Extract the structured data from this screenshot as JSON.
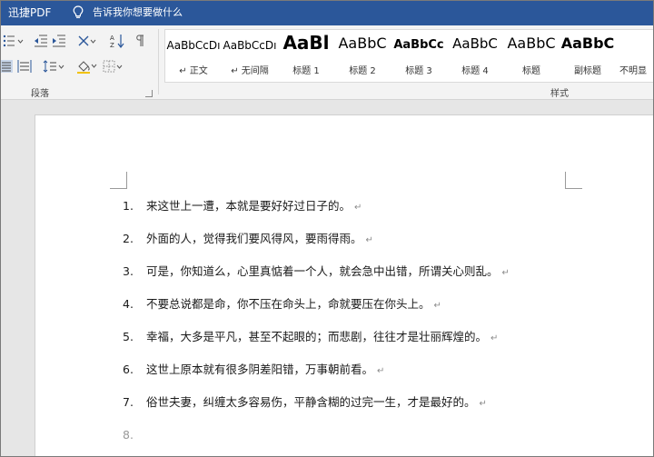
{
  "app": {
    "title": "迅捷PDF",
    "tell_me": "告诉我你想要做什么"
  },
  "ribbon": {
    "paragraph_group_label": "段落",
    "styles_group_label": "样式",
    "styles": [
      {
        "sample": "AaBbCcDı",
        "name": "↵ 正文"
      },
      {
        "sample": "AaBbCcDı",
        "name": "↵ 无间隔"
      },
      {
        "sample": "AaBl",
        "name": "标题 1"
      },
      {
        "sample": "AaBbC",
        "name": "标题 2"
      },
      {
        "sample": "AaBbCc",
        "name": "标题 3"
      },
      {
        "sample": "AaBbC",
        "name": "标题 4"
      },
      {
        "sample": "AaBbC",
        "name": "标题"
      },
      {
        "sample": "AaBbC",
        "name": "副标题"
      },
      {
        "sample": "",
        "name": "不明显"
      }
    ]
  },
  "document": {
    "list": [
      {
        "num": "1.",
        "text": "来这世上一遭，本就是要好好过日子的。",
        "mark": "↵"
      },
      {
        "num": "2.",
        "text": "外面的人，觉得我们要风得风，要雨得雨。",
        "mark": "↵"
      },
      {
        "num": "3.",
        "text": "可是，你知道么，心里真惦着一个人，就会急中出错，所谓关心则乱。",
        "mark": "↵"
      },
      {
        "num": "4.",
        "text": "不要总说都是命，你不压在命头上，命就要压在你头上。",
        "mark": "↵"
      },
      {
        "num": "5.",
        "text": "幸福，大多是平凡，甚至不起眼的；而悲剧，往往才是壮丽辉煌的。",
        "mark": "↵"
      },
      {
        "num": "6.",
        "text": "这世上原本就有很多阴差阳错，万事朝前看。",
        "mark": "↵"
      },
      {
        "num": "7.",
        "text": "俗世夫妻，纠缠太多容易伤，平静含糊的过完一生，才是最好的。",
        "mark": "↵"
      }
    ],
    "empty_item_num": "8."
  },
  "colors": {
    "title_bar": "#2b579a",
    "ribbon_bg": "#f3f3f3",
    "doc_bg": "#e6e6e6",
    "page_bg": "#ffffff",
    "spell_squiggle_blue": "#3b63c9",
    "spell_squiggle_red": "#d03030"
  },
  "icons": [
    "lightbulb-icon",
    "bullets-icon",
    "decrease-indent-icon",
    "increase-indent-icon",
    "chinese-layout-icon",
    "sort-icon",
    "show-marks-icon",
    "justify-icon",
    "distributed-icon",
    "line-spacing-icon",
    "shading-icon",
    "borders-icon"
  ]
}
